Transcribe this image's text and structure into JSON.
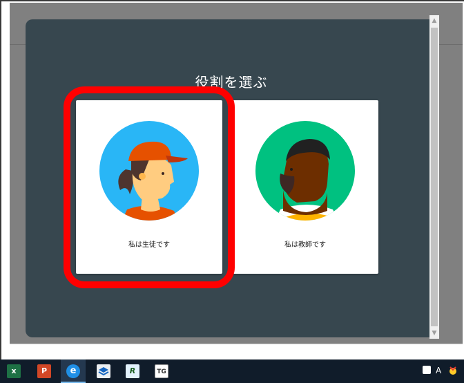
{
  "dialog": {
    "title": "役割を選ぶ"
  },
  "roles": [
    {
      "label": "私は生徒です",
      "avatar_icon": "student-avatar-icon"
    },
    {
      "label": "私は教師です",
      "avatar_icon": "teacher-avatar-icon"
    }
  ],
  "annotation": {
    "color": "#ff0000",
    "target": "student-card"
  },
  "colors": {
    "dialog_bg": "#37474f",
    "backdrop": "#808080",
    "student_circle": "#29b6f6",
    "teacher_circle": "#00c180"
  },
  "taskbar": {
    "apps": [
      {
        "icon": "excel-icon",
        "text": "x"
      },
      {
        "icon": "powerpoint-icon",
        "text": "P"
      },
      {
        "icon": "edge-icon",
        "text": "e"
      },
      {
        "icon": "app-stack-icon",
        "text": ""
      },
      {
        "icon": "r-app-icon",
        "text": "R"
      },
      {
        "icon": "tg-app-icon",
        "text": "TG"
      }
    ],
    "tray": {
      "ime_label": "A"
    }
  }
}
